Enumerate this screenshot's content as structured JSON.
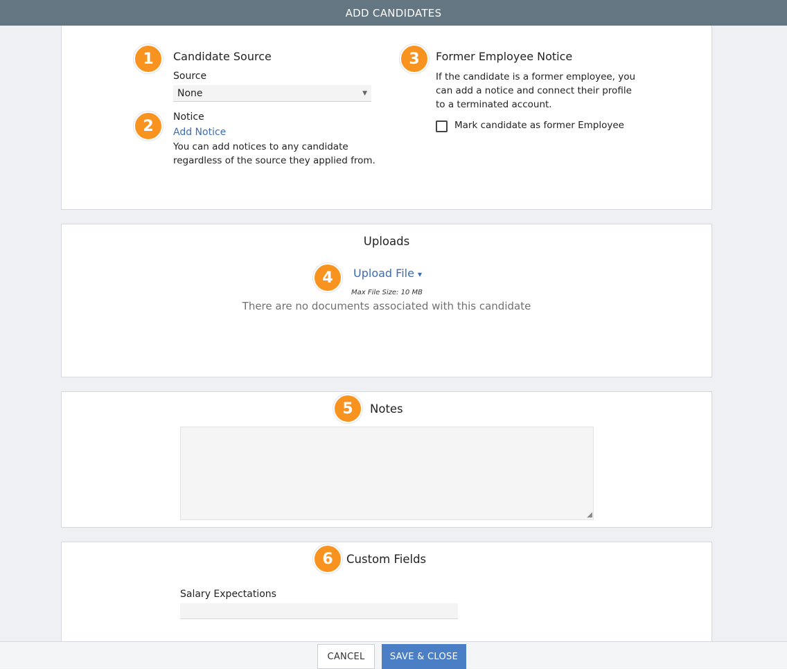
{
  "header": {
    "title": "ADD CANDIDATES"
  },
  "badges": [
    "1",
    "2",
    "3",
    "4",
    "5",
    "6"
  ],
  "candidate_source": {
    "title": "Candidate Source",
    "source_label": "Source",
    "source_value": "None",
    "caret": "▼"
  },
  "notice": {
    "label": "Notice",
    "add_link": "Add Notice",
    "help_line1": "You can add notices to any candidate",
    "help_line2": "regardless of the source they applied from."
  },
  "former_employee": {
    "title": "Former Employee Notice",
    "desc_line1": "If the candidate is a former employee, you",
    "desc_line2": "can add a notice and connect their profile",
    "desc_line3": "to a terminated account.",
    "checkbox_label": "Mark candidate as former Employee"
  },
  "uploads": {
    "title": "Uploads",
    "upload_button": "Upload File",
    "upload_caret": "▾",
    "max_size": "Max File Size: 10 MB",
    "empty_message": "There are no documents associated with this candidate"
  },
  "notes": {
    "title": "Notes"
  },
  "custom_fields": {
    "title": "Custom Fields",
    "salary_label": "Salary Expectations"
  },
  "footer": {
    "cancel_label": "CANCEL",
    "save_label": "SAVE & CLOSE"
  }
}
